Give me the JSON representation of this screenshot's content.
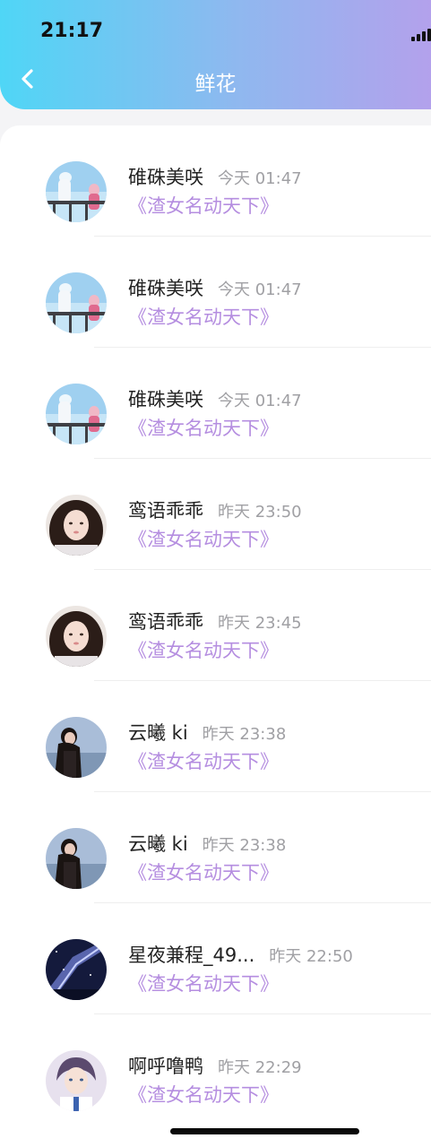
{
  "status_bar": {
    "time": "21:17"
  },
  "header": {
    "title": "鲜花"
  },
  "items": [
    {
      "name": "碓硃美咲",
      "time": "今天 01:47",
      "book": "《渣女名动天下》",
      "avatar": "anime-railing"
    },
    {
      "name": "碓硃美咲",
      "time": "今天 01:47",
      "book": "《渣女名动天下》",
      "avatar": "anime-railing"
    },
    {
      "name": "碓硃美咲",
      "time": "今天 01:47",
      "book": "《渣女名动天下》",
      "avatar": "anime-railing"
    },
    {
      "name": "鸾语乖乖",
      "time": "昨天 23:50",
      "book": "《渣女名动天下》",
      "avatar": "girl-portrait"
    },
    {
      "name": "鸾语乖乖",
      "time": "昨天 23:45",
      "book": "《渣女名动天下》",
      "avatar": "girl-portrait"
    },
    {
      "name": "云曦 ki",
      "time": "昨天 23:38",
      "book": "《渣女名动天下》",
      "avatar": "girl-sky"
    },
    {
      "name": "云曦 ki",
      "time": "昨天 23:38",
      "book": "《渣女名动天下》",
      "avatar": "girl-sky"
    },
    {
      "name": "星夜兼程_49...",
      "time": "昨天 22:50",
      "book": "《渣女名动天下》",
      "avatar": "starry-night"
    },
    {
      "name": "啊呼噜鸭",
      "time": "昨天 22:29",
      "book": "《渣女名动天下》",
      "avatar": "anime-boy"
    }
  ],
  "colors": {
    "header_gradient": [
      "#4fd6f6",
      "#8fb8ef",
      "#b3a1ec"
    ],
    "book_title": "#b58ee0",
    "time_text": "#a0a0a4"
  }
}
